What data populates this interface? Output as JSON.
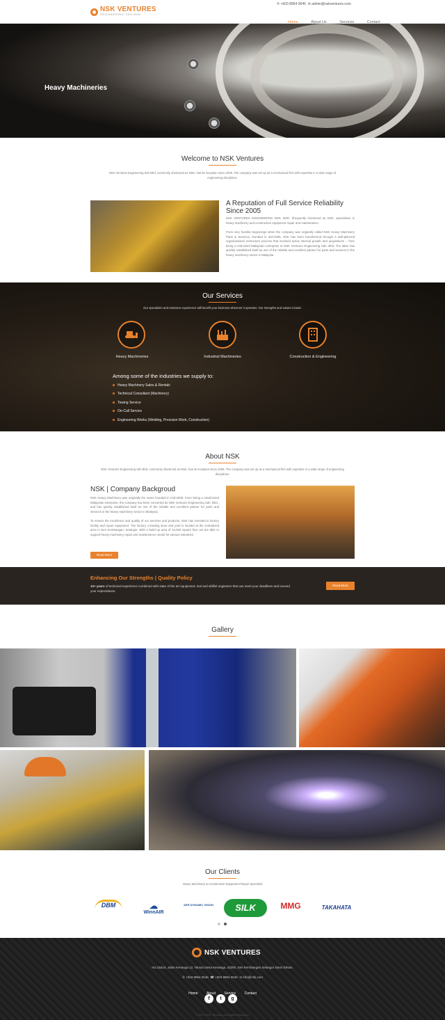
{
  "header": {
    "logo_name": "NSK VENTURES",
    "logo_sub": "ENGINEERING SDN BHD",
    "phone": "+603 8964 0646",
    "email": "admin@nskventures.com",
    "nav": [
      "Home",
      "About Us",
      "Services",
      "Contact"
    ]
  },
  "hero": {
    "title": "Heavy Machineries"
  },
  "welcome": {
    "title": "Welcome to NSK Ventures",
    "text": "NSK Ventures Engineering Sdn Bhd, commonly shortened as NSK, has its inception since 2005. The company was set up as a mechanical firm with expertise in a wide range of engineering disciplines."
  },
  "reputation": {
    "title": "A Reputation of Full Service Reliability Since 2005",
    "p1": "NSK VENTURES ENGINEERING SDN. BHD. (frequently shortened as NSK, specialises in heavy machinery and construction equipment repair and maintenance.",
    "p2": "From very humble beginnings when the company was originally called NSK Heavy Machinery Parts & Services, founded in mid-2005, NSK has been transformed through a well-planned organizational restructure process that involved active internal growth and acquisitions – from being a mid-sized Malaysian enterprise to NSK Ventures Engineering Sdn. Bhd. The latter has quickly established itself as one of the reliable and excellent partner for parts and services in the heavy machinery sector in Malaysia."
  },
  "services": {
    "title": "Our Services",
    "intro": "Our specialism and extensive experience will benefit your business wherever it operates. Our strengths and values include:",
    "items": [
      {
        "label": "Heavy Machineries",
        "icon": "bulldozer-icon"
      },
      {
        "label": "Industrial Machineries",
        "icon": "factory-icon"
      },
      {
        "label": "Construction & Engineering",
        "icon": "building-icon"
      }
    ],
    "industries_title": "Among some of the industries we supply to:",
    "industries": [
      "Heavy Machinery Sales & Rentals",
      "Technical Consultant (Machinery)",
      "Towing Service",
      "On-Call Service",
      "Engineering Works (Welding, Precision Work, Construction)"
    ]
  },
  "about": {
    "title": "About NSK",
    "intro": "NSK Ventures Engineering Sdn Bhd, commonly shortened as NSK, has its inception since 2005. The company was set up as a mechanical firm with expertise in a wide range of engineering disciplines.",
    "bg_title": "NSK | Company Backgroud",
    "p1": "NSK Heavy Machinery was originally the name founded in mid-2005. From being a small-sized Malaysian enterprise, the company has been converted as NSK Ventures Engineering Sdn. Bhd., and has quickly established itself as one of the reliable and excellent partner for parts and services in the heavy machinery sector in Malaysia.",
    "p2": "To ensure the excellence and quality of our services and products, NSK has invested in factory facility and repair equipment. The factory, including store and yard is located at the centralized area in Seri Kembangan, Selangor. With a build up area of 10,000 square feet, we are able to support heavy machinery repair and maintenance needs for various industries.",
    "button": "Read More"
  },
  "quality": {
    "title": "Enhancing Our Strengths | Quality Policy",
    "bold": "10+ years",
    "text": " of technical experience combined with state of the art equipment, tool and skillful engineers that can meet your deadlines and exceed your expectations.",
    "button": "Read More"
  },
  "gallery": {
    "title": "Gallery"
  },
  "clients": {
    "title": "Our Clients",
    "subtitle": "Heavy Machinery & Construction Equipment Repair Specialist",
    "logos": [
      "DBM",
      "WinnAIR",
      "AER DYNAMIC VISION",
      "SILK",
      "MMG",
      "TAKAHATA"
    ]
  },
  "footer": {
    "logo_name": "NSK VENTURES",
    "address": "No.22&24, Jalan Kenanga 12, Taman Desa Kenanga, 43300, Seri Kembangan Selangor Darul Ehsan.",
    "phone1": "+603 8964 0646",
    "phone2": "+603 8964 0646",
    "email": "info@nsk.com",
    "nav": [
      "Home",
      "About",
      "Service",
      "Contact"
    ],
    "copyright": "© 2017 NSK Ventures. All Rights Reserved."
  },
  "colors": {
    "accent": "#e8822d",
    "dark": "#2a2420"
  }
}
